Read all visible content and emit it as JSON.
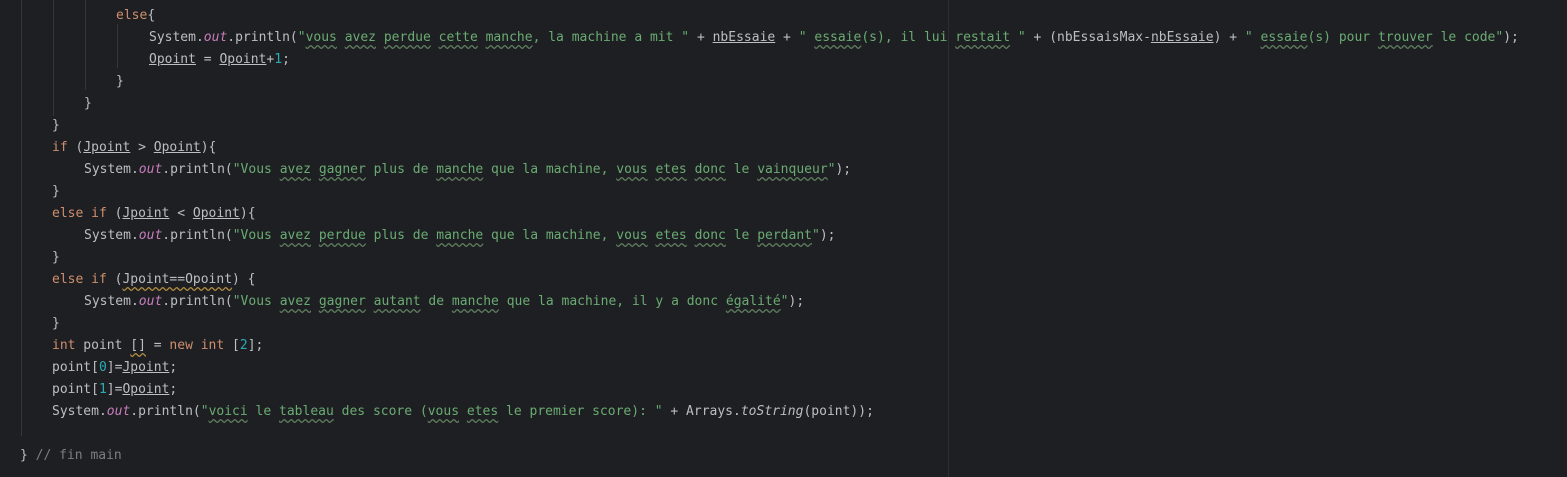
{
  "colors": {
    "background": "#1e1f22",
    "default_text": "#bcbec4",
    "keyword": "#cf8e6d",
    "string": "#6aab73",
    "number": "#2aacb8",
    "static_field": "#c77dbb",
    "comment": "#7a7e85"
  },
  "lines": [
    {
      "indent": 116,
      "tokens": [
        {
          "t": "else",
          "c": "kw"
        },
        {
          "t": "{",
          "c": ""
        }
      ]
    },
    {
      "indent": 149,
      "tokens": [
        {
          "t": "System.",
          "c": ""
        },
        {
          "t": "out",
          "c": "fld"
        },
        {
          "t": ".println(",
          "c": ""
        },
        {
          "t": "\"",
          "c": "str"
        },
        {
          "t": "vous",
          "c": "str wavy"
        },
        {
          "t": " ",
          "c": "str"
        },
        {
          "t": "avez",
          "c": "str wavy"
        },
        {
          "t": " ",
          "c": "str"
        },
        {
          "t": "perdue",
          "c": "str wavy"
        },
        {
          "t": " ",
          "c": "str"
        },
        {
          "t": "cette",
          "c": "str wavy"
        },
        {
          "t": " ",
          "c": "str"
        },
        {
          "t": "manche",
          "c": "str wavy"
        },
        {
          "t": ", la machine a mit \"",
          "c": "str"
        },
        {
          "t": " + ",
          "c": ""
        },
        {
          "t": "nbEssaie",
          "c": "ul"
        },
        {
          "t": " + ",
          "c": ""
        },
        {
          "t": "\" ",
          "c": "str"
        },
        {
          "t": "essaie",
          "c": "str wavy"
        },
        {
          "t": "(s), il lui ",
          "c": "str"
        },
        {
          "t": "restait",
          "c": "str wavy"
        },
        {
          "t": " \"",
          "c": "str"
        },
        {
          "t": " + (nbEssaisMax-",
          "c": ""
        },
        {
          "t": "nbEssaie",
          "c": "ul"
        },
        {
          "t": ") + ",
          "c": ""
        },
        {
          "t": "\" ",
          "c": "str"
        },
        {
          "t": "essaie",
          "c": "str wavy"
        },
        {
          "t": "(s) pour ",
          "c": "str"
        },
        {
          "t": "trouver",
          "c": "str wavy"
        },
        {
          "t": " le code\"",
          "c": "str"
        },
        {
          "t": ");",
          "c": ""
        }
      ]
    },
    {
      "indent": 149,
      "tokens": [
        {
          "t": "Opoint",
          "c": "ul"
        },
        {
          "t": " = ",
          "c": ""
        },
        {
          "t": "Opoint",
          "c": "ul"
        },
        {
          "t": "+",
          "c": ""
        },
        {
          "t": "1",
          "c": "num"
        },
        {
          "t": ";",
          "c": ""
        }
      ]
    },
    {
      "indent": 116,
      "tokens": [
        {
          "t": "}",
          "c": ""
        }
      ]
    },
    {
      "indent": 84,
      "tokens": [
        {
          "t": "}",
          "c": ""
        }
      ]
    },
    {
      "indent": 52,
      "tokens": [
        {
          "t": "}",
          "c": ""
        }
      ]
    },
    {
      "indent": 52,
      "tokens": [
        {
          "t": "if",
          "c": "kw"
        },
        {
          "t": " (",
          "c": ""
        },
        {
          "t": "Jpoint",
          "c": "ul"
        },
        {
          "t": " > ",
          "c": ""
        },
        {
          "t": "Opoint",
          "c": "ul"
        },
        {
          "t": "){",
          "c": ""
        }
      ]
    },
    {
      "indent": 84,
      "tokens": [
        {
          "t": "System.",
          "c": ""
        },
        {
          "t": "out",
          "c": "fld"
        },
        {
          "t": ".println(",
          "c": ""
        },
        {
          "t": "\"Vous ",
          "c": "str"
        },
        {
          "t": "avez",
          "c": "str wavy"
        },
        {
          "t": " ",
          "c": "str"
        },
        {
          "t": "gagner",
          "c": "str wavy"
        },
        {
          "t": " plus de ",
          "c": "str"
        },
        {
          "t": "manche",
          "c": "str wavy"
        },
        {
          "t": " que la machine, ",
          "c": "str"
        },
        {
          "t": "vous",
          "c": "str wavy"
        },
        {
          "t": " ",
          "c": "str"
        },
        {
          "t": "etes",
          "c": "str wavy"
        },
        {
          "t": " ",
          "c": "str"
        },
        {
          "t": "donc",
          "c": "str wavy"
        },
        {
          "t": " le ",
          "c": "str"
        },
        {
          "t": "vainqueur",
          "c": "str wavy"
        },
        {
          "t": "\"",
          "c": "str"
        },
        {
          "t": ");",
          "c": ""
        }
      ]
    },
    {
      "indent": 52,
      "tokens": [
        {
          "t": "}",
          "c": ""
        }
      ]
    },
    {
      "indent": 52,
      "tokens": [
        {
          "t": "else if",
          "c": "kw"
        },
        {
          "t": " (",
          "c": ""
        },
        {
          "t": "Jpoint",
          "c": "ul"
        },
        {
          "t": " < ",
          "c": ""
        },
        {
          "t": "Opoint",
          "c": "ul"
        },
        {
          "t": "){",
          "c": ""
        }
      ]
    },
    {
      "indent": 84,
      "tokens": [
        {
          "t": "System.",
          "c": ""
        },
        {
          "t": "out",
          "c": "fld"
        },
        {
          "t": ".println(",
          "c": ""
        },
        {
          "t": "\"Vous ",
          "c": "str"
        },
        {
          "t": "avez",
          "c": "str wavy"
        },
        {
          "t": " ",
          "c": "str"
        },
        {
          "t": "perdue",
          "c": "str wavy"
        },
        {
          "t": " plus de ",
          "c": "str"
        },
        {
          "t": "manche",
          "c": "str wavy"
        },
        {
          "t": " que la machine, ",
          "c": "str"
        },
        {
          "t": "vous",
          "c": "str wavy"
        },
        {
          "t": " ",
          "c": "str"
        },
        {
          "t": "etes",
          "c": "str wavy"
        },
        {
          "t": " ",
          "c": "str"
        },
        {
          "t": "donc",
          "c": "str wavy"
        },
        {
          "t": " le ",
          "c": "str"
        },
        {
          "t": "perdant",
          "c": "str wavy"
        },
        {
          "t": "\"",
          "c": "str"
        },
        {
          "t": ");",
          "c": ""
        }
      ]
    },
    {
      "indent": 52,
      "tokens": [
        {
          "t": "}",
          "c": ""
        }
      ]
    },
    {
      "indent": 52,
      "tokens": [
        {
          "t": "else if",
          "c": "kw"
        },
        {
          "t": " (",
          "c": ""
        },
        {
          "t": "Jpoint==Opoint",
          "c": "warn"
        },
        {
          "t": ") {",
          "c": ""
        }
      ]
    },
    {
      "indent": 84,
      "tokens": [
        {
          "t": "System.",
          "c": ""
        },
        {
          "t": "out",
          "c": "fld"
        },
        {
          "t": ".println(",
          "c": ""
        },
        {
          "t": "\"Vous ",
          "c": "str"
        },
        {
          "t": "avez",
          "c": "str wavy"
        },
        {
          "t": " ",
          "c": "str"
        },
        {
          "t": "gagner",
          "c": "str wavy"
        },
        {
          "t": " ",
          "c": "str"
        },
        {
          "t": "autant",
          "c": "str wavy"
        },
        {
          "t": " de ",
          "c": "str"
        },
        {
          "t": "manche",
          "c": "str wavy"
        },
        {
          "t": " que la machine, il y a donc ",
          "c": "str"
        },
        {
          "t": "égalité",
          "c": "str wavy"
        },
        {
          "t": "\"",
          "c": "str"
        },
        {
          "t": ");",
          "c": ""
        }
      ]
    },
    {
      "indent": 52,
      "tokens": [
        {
          "t": "}",
          "c": ""
        }
      ]
    },
    {
      "indent": 52,
      "tokens": [
        {
          "t": "int",
          "c": "kw"
        },
        {
          "t": " point ",
          "c": ""
        },
        {
          "t": "[]",
          "c": "warn"
        },
        {
          "t": " = ",
          "c": ""
        },
        {
          "t": "new",
          "c": "kw"
        },
        {
          "t": " ",
          "c": ""
        },
        {
          "t": "int",
          "c": "kw"
        },
        {
          "t": " [",
          "c": ""
        },
        {
          "t": "2",
          "c": "num"
        },
        {
          "t": "];",
          "c": ""
        }
      ]
    },
    {
      "indent": 52,
      "tokens": [
        {
          "t": "point[",
          "c": ""
        },
        {
          "t": "0",
          "c": "num"
        },
        {
          "t": "]=",
          "c": ""
        },
        {
          "t": "Jpoint",
          "c": "ul"
        },
        {
          "t": ";",
          "c": ""
        }
      ]
    },
    {
      "indent": 52,
      "tokens": [
        {
          "t": "point[",
          "c": ""
        },
        {
          "t": "1",
          "c": "num"
        },
        {
          "t": "]=",
          "c": ""
        },
        {
          "t": "Opoint",
          "c": "ul"
        },
        {
          "t": ";",
          "c": ""
        }
      ]
    },
    {
      "indent": 52,
      "tokens": [
        {
          "t": "System.",
          "c": ""
        },
        {
          "t": "out",
          "c": "fld"
        },
        {
          "t": ".println(",
          "c": ""
        },
        {
          "t": "\"",
          "c": "str"
        },
        {
          "t": "voici",
          "c": "str wavy"
        },
        {
          "t": " le ",
          "c": "str"
        },
        {
          "t": "tableau",
          "c": "str wavy"
        },
        {
          "t": " des score (",
          "c": "str"
        },
        {
          "t": "vous",
          "c": "str wavy"
        },
        {
          "t": " ",
          "c": "str"
        },
        {
          "t": "etes",
          "c": "str wavy"
        },
        {
          "t": " le premier score): \"",
          "c": "str"
        },
        {
          "t": " + Arrays.",
          "c": ""
        },
        {
          "t": "toString",
          "c": "ital"
        },
        {
          "t": "(point));",
          "c": ""
        }
      ]
    },
    {
      "indent": 20,
      "tokens": []
    },
    {
      "indent": 20,
      "tokens": [
        {
          "t": "}",
          "c": ""
        },
        {
          "t": " // fin main",
          "c": "cmt"
        }
      ]
    }
  ]
}
